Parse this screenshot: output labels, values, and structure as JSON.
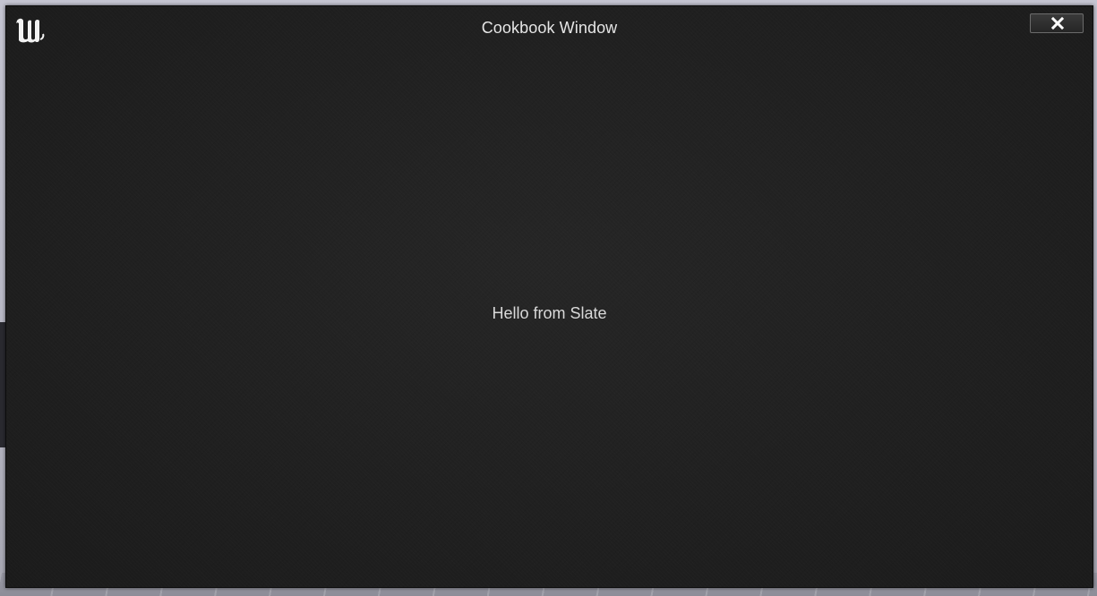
{
  "window": {
    "title": "Cookbook Window",
    "logo_icon": "unreal-engine-logo-icon",
    "close_icon": "close-icon"
  },
  "content": {
    "message": "Hello from Slate"
  },
  "colors": {
    "window_background": "#202020",
    "title_text": "#e6e6e6",
    "body_text": "#d9d9d9"
  }
}
